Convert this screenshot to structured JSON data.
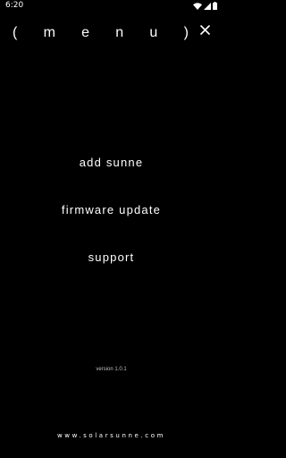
{
  "status_bar": {
    "time": "6:20",
    "icons": [
      "wifi-icon",
      "cellular-icon",
      "battery-icon"
    ]
  },
  "header": {
    "title": "( m e n u )",
    "close_icon": "close-icon"
  },
  "menu": {
    "items": [
      {
        "label": "add sunne"
      },
      {
        "label": "firmware update"
      },
      {
        "label": "support"
      }
    ]
  },
  "footer": {
    "version": "version 1.0.1",
    "website": "www.solarsunne.com"
  },
  "colors": {
    "background": "#000000",
    "text": "#ffffff",
    "muted": "#bfbfbf"
  }
}
